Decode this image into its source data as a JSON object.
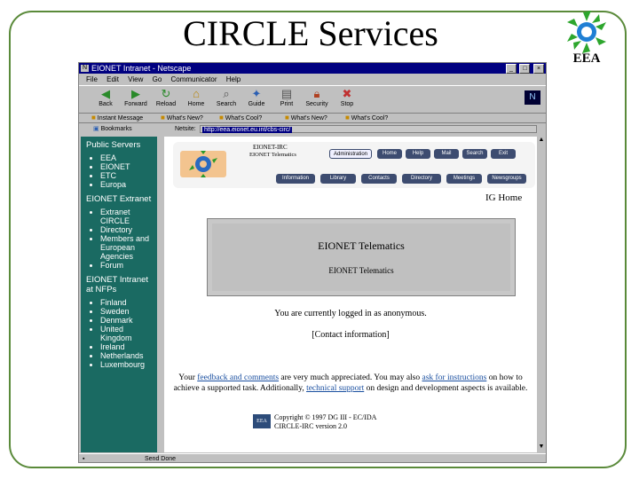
{
  "slide": {
    "title": "CIRCLE Services",
    "logo_text": "EEA"
  },
  "browser": {
    "window_title": "EIONET Intranet - Netscape",
    "menu": [
      "File",
      "Edit",
      "View",
      "Go",
      "Communicator",
      "Help"
    ],
    "toolbar": [
      {
        "label": "Back",
        "icon": "arrow-left-icon"
      },
      {
        "label": "Forward",
        "icon": "arrow-right-icon"
      },
      {
        "label": "Reload",
        "icon": "reload-icon"
      },
      {
        "label": "Home",
        "icon": "home-icon"
      },
      {
        "label": "Search",
        "icon": "search-icon"
      },
      {
        "label": "Guide",
        "icon": "guide-icon"
      },
      {
        "label": "Print",
        "icon": "print-icon"
      },
      {
        "label": "Security",
        "icon": "lock-icon"
      },
      {
        "label": "Stop",
        "icon": "stop-icon"
      }
    ],
    "personal_toolbar": [
      "Instant Message",
      "What's New?",
      "What's Cool?",
      "What's New?",
      "What's Cool?"
    ],
    "bookmarks_label": "Bookmarks",
    "location_label": "Netsite:",
    "location_value": "http://eea.eionet.eu.int/cbs-circ/",
    "status_text": "Send Done"
  },
  "sidebar": {
    "sections": [
      {
        "heading": "Public Servers",
        "items": [
          "EEA",
          "EIONET",
          "ETC",
          "Europa"
        ]
      },
      {
        "heading": "EIONET Extranet",
        "items": [
          "Extranet CIRCLE",
          "Directory",
          "Members and European Agencies",
          "Forum"
        ]
      },
      {
        "heading": "EIONET Intranet at NFPs",
        "items": [
          "Finland",
          "Sweden",
          "Denmark",
          "United Kingdom",
          "Ireland",
          "Netherlands",
          "Luxembourg"
        ]
      }
    ]
  },
  "content": {
    "banner_title": "EIONET-IRC",
    "banner_subtitle": "EIONET Telematics",
    "top_buttons": [
      "Administration",
      "Home",
      "Help",
      "Mail",
      "Search",
      "Exit"
    ],
    "bottom_buttons": [
      "Information",
      "Library",
      "Contacts",
      "Directory",
      "Meetings",
      "Newsgroups"
    ],
    "ig_home": "IG Home",
    "box_title": "EIONET Telematics",
    "box_subtitle": "EIONET Telematics",
    "logged_text": "You are currently logged in as anonymous.",
    "contact_text": "[Contact information]",
    "feedback": {
      "p1": "Your ",
      "link1": "feedback and comments",
      "p2": " are very much appreciated. You may also ",
      "link2": "ask for instructions",
      "p3": " on how to achieve a supported task. Additionally, ",
      "link3": "technical support",
      "p4": " on design and development aspects is available."
    },
    "copyright_line1": "Copyright © 1997 DG III - EC/IDA",
    "copyright_line2": "CIRCLE-IRC version 2.0",
    "copy_logo": "EEA"
  }
}
